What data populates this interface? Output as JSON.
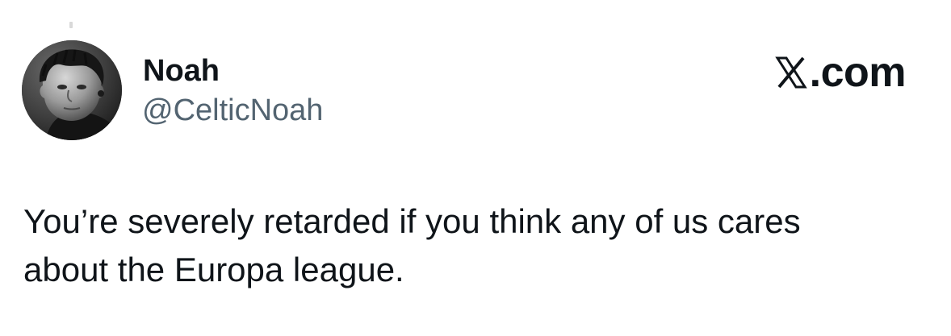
{
  "author": {
    "display_name": "Noah",
    "handle": "@CelticNoah",
    "avatar_icon": "profile-photo-avatar"
  },
  "brand": {
    "icon": "x-logo-icon",
    "domain_suffix": ".com"
  },
  "tweet": {
    "text": "You’re severely retarded if you think any of us cares\nabout the Europa league."
  },
  "colors": {
    "text_primary": "#0f1419",
    "text_secondary": "#536471",
    "background": "#ffffff"
  }
}
